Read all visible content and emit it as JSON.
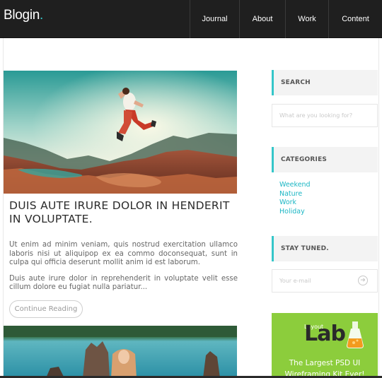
{
  "header": {
    "logo": "Blogin",
    "logo_dot": ".",
    "nav": [
      {
        "label": "Journal"
      },
      {
        "label": "About"
      },
      {
        "label": "Work"
      },
      {
        "label": "Content"
      }
    ]
  },
  "post": {
    "title": "DUIS AUTE IRURE DOLOR IN HENDERIT IN VOLUPTATE.",
    "paragraph_1": "Ut enim ad minim veniam, quis nostrud exercitation ullamco laboris nisi ut aliquipop ex ea commo doconsequat, sunt in culpa qui officia deserunt mollit anim id est laborum.",
    "paragraph_2": "Duis aute irure dolor in reprehenderit in voluptate velit esse cillum dolore eu fugiat nulla pariatur...",
    "continue_label": "Continue Reading"
  },
  "sidebar": {
    "search_heading": "SEARCH",
    "search_placeholder": "What are you looking for?",
    "categories_heading": "CATEGORIES",
    "categories": [
      "Weekend",
      "Nature",
      "Work",
      "Holiday"
    ],
    "stay_heading": "STAY TUNED.",
    "email_placeholder": "Your e-mail",
    "submit_icon": "arrow-right-circle-icon"
  },
  "ad": {
    "logo_small": "Layout",
    "logo_main": "Lab",
    "line_1": "The Largest PSD UI",
    "line_2": "Wireframing Kit Ever!"
  },
  "colors": {
    "accent": "#35c6c9",
    "link": "#1bb6c4",
    "topbar": "#1f1f1f",
    "ad_green": "#8ccd3c"
  }
}
